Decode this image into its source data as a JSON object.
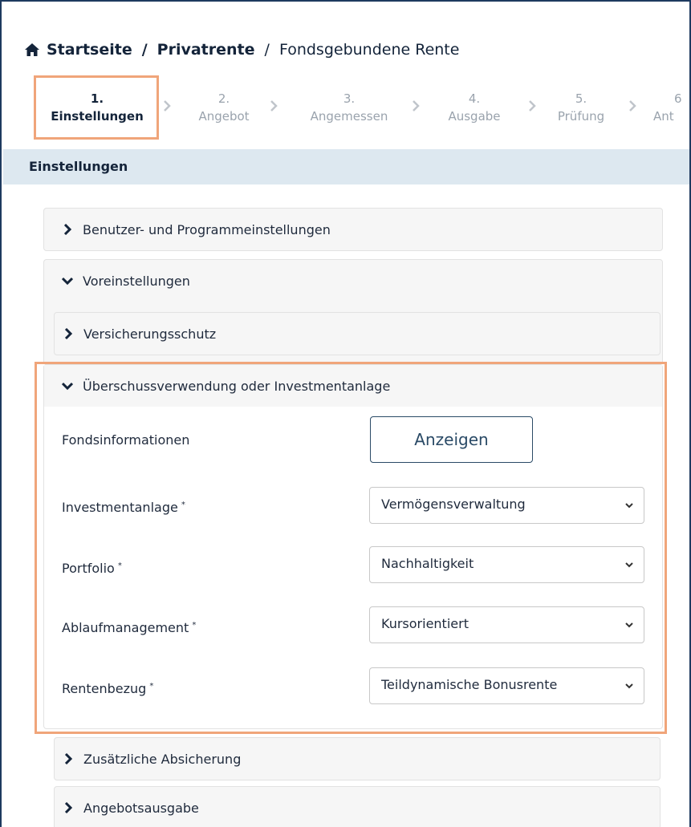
{
  "breadcrumb": {
    "home": "Startseite",
    "sep1": "/",
    "product": "Privatrente",
    "sep2": "/",
    "current": "Fondsgebundene Rente"
  },
  "steps": [
    {
      "num": "1.",
      "label": "Einstellungen",
      "active": true
    },
    {
      "num": "2.",
      "label": "Angebot"
    },
    {
      "num": "3.",
      "label": "Angemessen"
    },
    {
      "num": "4.",
      "label": "Ausgabe"
    },
    {
      "num": "5.",
      "label": "Prüfung"
    },
    {
      "num": "6",
      "label": "Ant"
    }
  ],
  "section_title": "Einstellungen",
  "panels": {
    "user_settings": "Benutzer- und Programmeinstellungen",
    "presets": "Voreinstellungen",
    "insurance": "Versicherungsschutz",
    "surplus": "Überschussverwendung oder Investmentanlage",
    "additional": "Zusätzliche Absicherung",
    "offer_output": "Angebotsausgabe"
  },
  "form": {
    "fund_info_label": "Fondsinformationen",
    "fund_info_button": "Anzeigen",
    "required_mark": "*",
    "investment_label": "Investmentanlage",
    "investment_value": "Vermögensverwaltung",
    "portfolio_label": "Portfolio",
    "portfolio_value": "Nachhaltigkeit",
    "maturity_label": "Ablaufmanagement",
    "maturity_value": "Kursorientiert",
    "pension_label": "Rentenbezug",
    "pension_value": "Teildynamische Bonusrente"
  },
  "icons": {
    "home": "home-icon",
    "step_sep": "chevron-right-icon",
    "collapsed": "chevron-right-icon",
    "expanded": "chevron-down-icon",
    "select_caret": "chevron-down-icon"
  },
  "colors": {
    "highlight": "#f0a57a",
    "section_bg": "#dde8f0",
    "text_dark": "#14243a",
    "muted": "#9aa3ad"
  }
}
